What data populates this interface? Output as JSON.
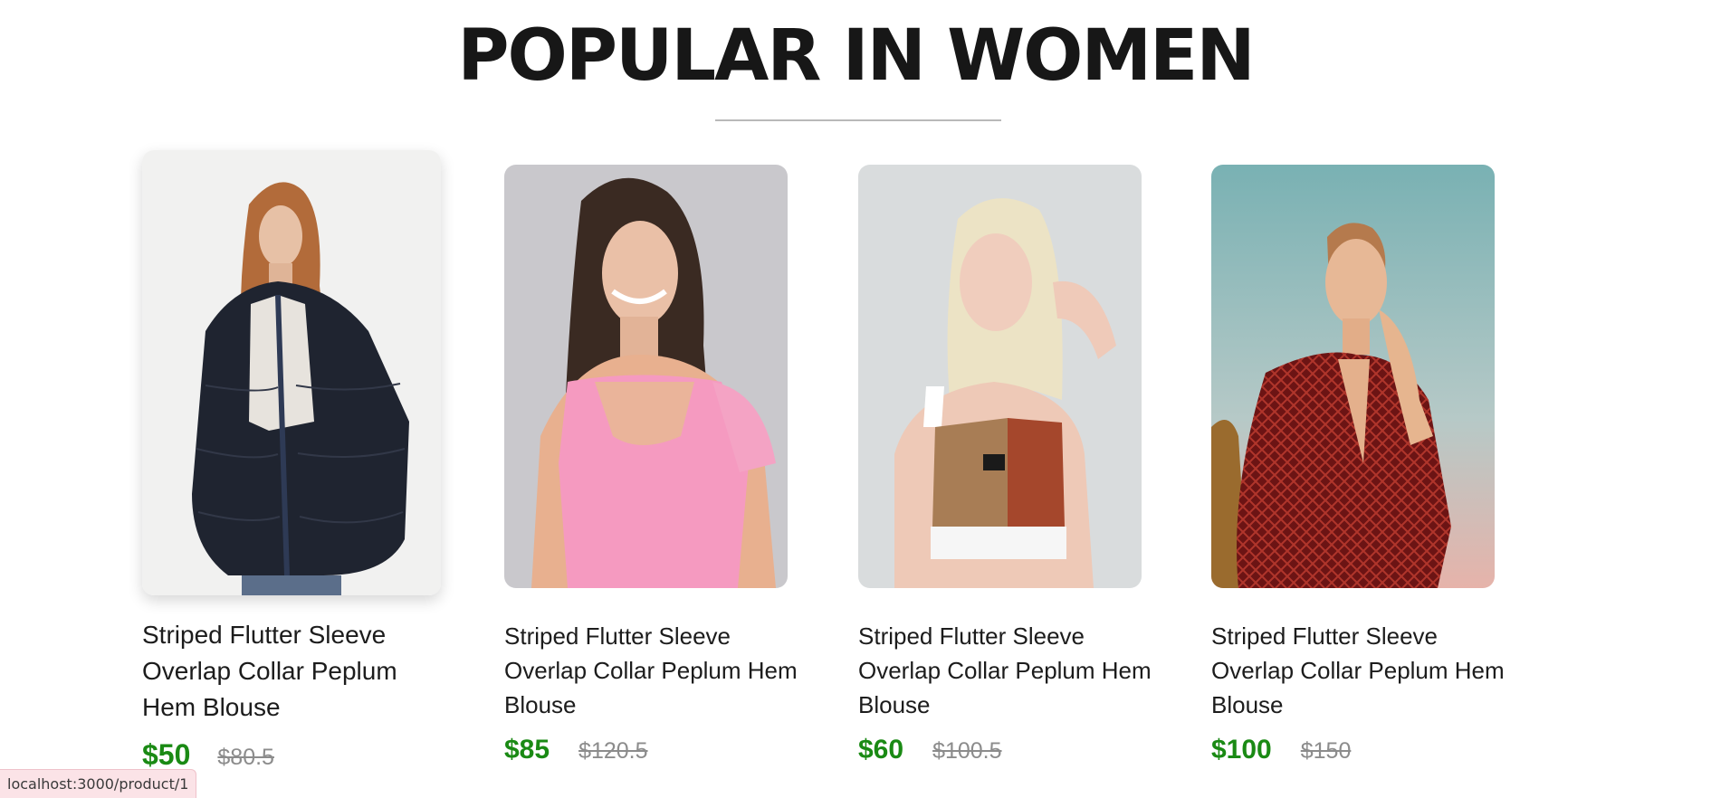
{
  "section": {
    "title": "POPULAR IN WOMEN"
  },
  "products": [
    {
      "name": "Striped Flutter Sleeve Overlap Collar Peplum Hem Blouse",
      "new_price": "$50",
      "old_price": "$80.5",
      "image": "woman-black-fur-jacket"
    },
    {
      "name": "Striped Flutter Sleeve Overlap Collar Peplum Hem Blouse",
      "new_price": "$85",
      "old_price": "$120.5",
      "image": "woman-pink-top"
    },
    {
      "name": "Striped Flutter Sleeve Overlap Collar Peplum Hem Blouse",
      "new_price": "$60",
      "old_price": "$100.5",
      "image": "woman-sports-crop-top"
    },
    {
      "name": "Striped Flutter Sleeve Overlap Collar Peplum Hem Blouse",
      "new_price": "$100",
      "old_price": "$150",
      "image": "woman-red-patterned-dress"
    }
  ],
  "status_bar": {
    "url": "localhost:3000/product/1"
  },
  "colors": {
    "heading": "#171717",
    "divider": "#b9b9b9",
    "price_new": "#1a8a14",
    "price_old": "#8c8c8c",
    "status_bg": "#fbe3e7"
  }
}
